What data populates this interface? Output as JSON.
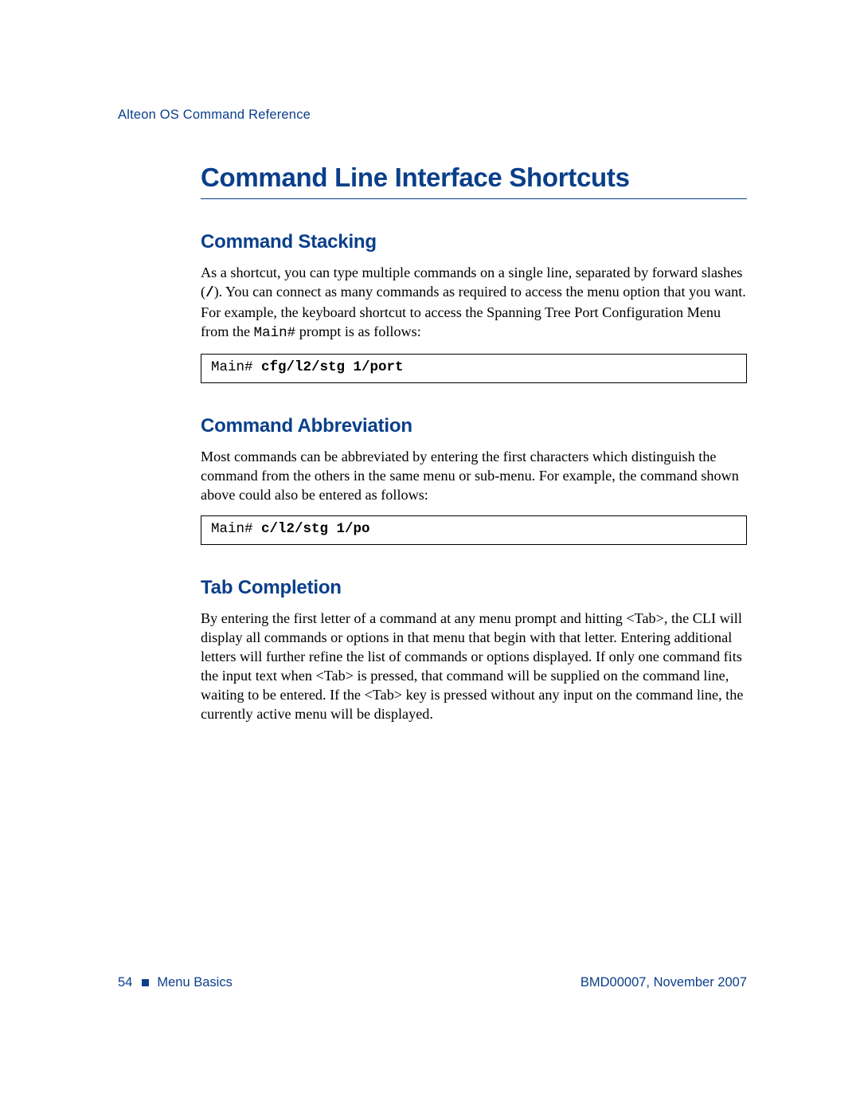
{
  "header": {
    "running_head": "Alteon OS Command Reference"
  },
  "title": "Command Line Interface Shortcuts",
  "sections": {
    "stacking": {
      "heading": "Command Stacking",
      "para_a": "As a shortcut, you can type multiple commands on a single line, separated by forward slashes (",
      "slash": "/",
      "para_b": "). You can connect as many commands as required to access the menu option that you want. For example, the keyboard shortcut to access the Spanning Tree Port Configuration Menu from the ",
      "prompt_inline": "Main#",
      "para_c": " prompt is as follows:",
      "code_prompt": "Main# ",
      "code_cmd": "cfg/l2/stg 1/port"
    },
    "abbrev": {
      "heading": "Command Abbreviation",
      "para": "Most commands can be abbreviated by entering the first characters which distinguish the command from the others in the same menu or sub-menu. For example, the command shown above could also be entered as follows:",
      "code_prompt": "Main# ",
      "code_cmd": "c/l2/stg 1/po"
    },
    "tab": {
      "heading": "Tab Completion",
      "para": "By entering the first letter of a command at any menu prompt and hitting <Tab>, the CLI will display all commands or options in that menu that begin with that letter. Entering additional letters will further refine the list of commands or options displayed. If only one command fits the input text when <Tab> is pressed, that command will be supplied on the command line, waiting to be entered. If the <Tab> key is pressed without any input on the command line, the currently active menu will be displayed."
    }
  },
  "footer": {
    "page_no": "54",
    "chapter": "Menu Basics",
    "docref": "BMD00007, November 2007"
  }
}
